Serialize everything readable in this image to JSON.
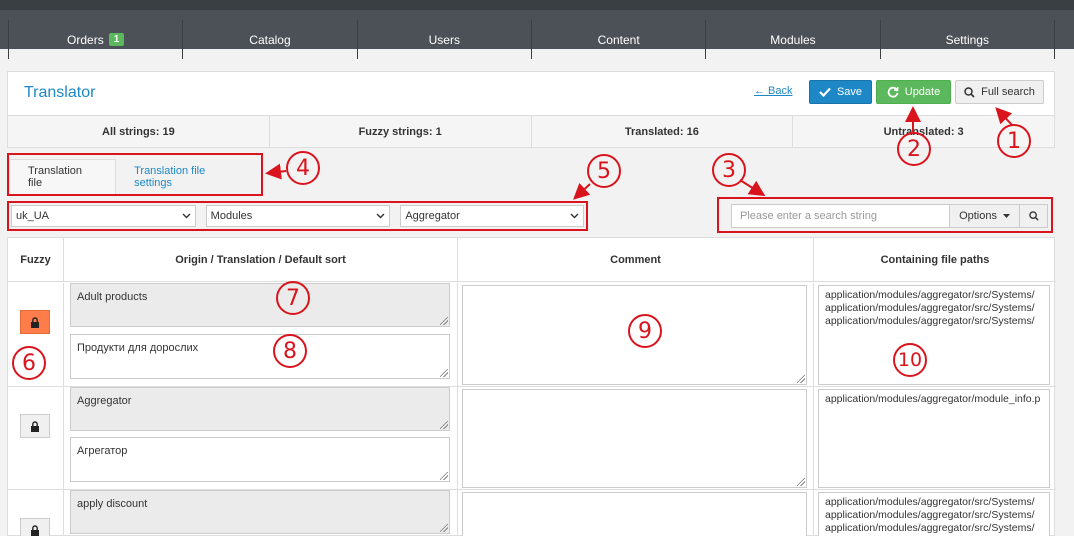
{
  "nav": {
    "items": [
      {
        "label": "Orders",
        "badge": "1"
      },
      {
        "label": "Catalog"
      },
      {
        "label": "Users"
      },
      {
        "label": "Content"
      },
      {
        "label": "Modules"
      },
      {
        "label": "Settings"
      }
    ]
  },
  "header": {
    "title": "Translator",
    "back_label": "← Back",
    "save_label": "Save",
    "update_label": "Update",
    "full_search_label": "Full search"
  },
  "stats": {
    "all": "All strings: 19",
    "fuzzy": "Fuzzy strings: 1",
    "translated": "Translated: 16",
    "untranslated": "Untranslated: 3"
  },
  "tabs": {
    "file": "Translation file",
    "settings": "Translation file settings"
  },
  "selects": {
    "locale": "uk_UA",
    "type": "Modules",
    "module": "Aggregator"
  },
  "search": {
    "placeholder": "Please enter a search string",
    "options_label": "Options"
  },
  "table": {
    "headers": {
      "fuzzy": "Fuzzy",
      "origin": "Origin / Translation / Default sort",
      "comment": "Comment",
      "paths": "Containing file paths"
    },
    "rows": [
      {
        "origin": "Adult products",
        "translation": "Продукти для дорослих",
        "comment": "",
        "fuzzy": true,
        "paths": [
          "application/modules/aggregator/src/Systems/",
          "application/modules/aggregator/src/Systems/",
          "application/modules/aggregator/src/Systems/"
        ]
      },
      {
        "origin": "Aggregator",
        "translation": "Агрегатор",
        "comment": "",
        "fuzzy": false,
        "paths": [
          "application/modules/aggregator/module_info.p"
        ]
      },
      {
        "origin": "apply discount",
        "translation": "",
        "comment": "",
        "fuzzy": false,
        "paths": [
          "application/modules/aggregator/src/Systems/",
          "application/modules/aggregator/src/Systems/",
          "application/modules/aggregator/src/Systems/"
        ]
      }
    ]
  },
  "annotations": [
    "1",
    "2",
    "3",
    "4",
    "5",
    "6",
    "7",
    "8",
    "9",
    "10"
  ],
  "colors": {
    "accent": "#1e88c7",
    "update": "#5cb85c",
    "fuzzy_on": "#ff7c4b",
    "annotation": "#d9141c",
    "nav_bg": "#4b5157"
  }
}
